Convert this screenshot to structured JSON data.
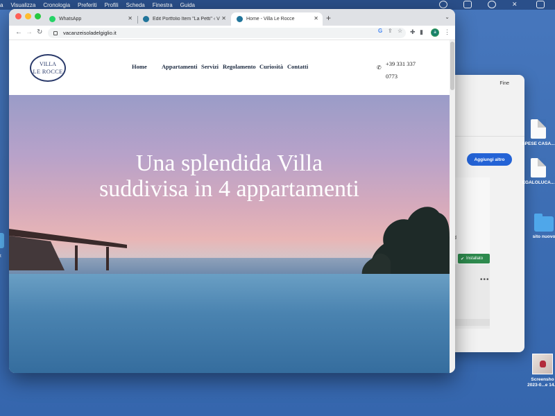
{
  "menubar": {
    "items": [
      "a",
      "Visualizza",
      "Cronologia",
      "Preferiti",
      "Profili",
      "Scheda",
      "Finestra",
      "Guida"
    ]
  },
  "browser": {
    "tabs": [
      {
        "title": "WhatsApp",
        "favicon": "whatsapp-icon",
        "color": "#25d366"
      },
      {
        "title": "Edit Portfolio Item \"La Petti\" ‹ V",
        "favicon": "wordpress-icon",
        "color": "#21759b"
      },
      {
        "title": "Home - Villa Le Rocce",
        "favicon": "wordpress-icon",
        "color": "#21759b",
        "active": true
      }
    ],
    "url": "vacanzeisoladelgiglio.it",
    "profile_initial": "a"
  },
  "site": {
    "logo_line1": "VILLA",
    "logo_line2": "LE ROCCE",
    "nav": [
      "Home",
      "Appartamenti",
      "Servizi",
      "Regolamento",
      "Curiosità",
      "Contatti"
    ],
    "phone": "+39 331 337 0773",
    "hero_title_line1": "Una splendida Villa",
    "hero_title_line2": "suddivisa in 4 appartamenti"
  },
  "background_window": {
    "done_label": "Fine",
    "add_button": "Aggiungi altro",
    "card_letter": "d",
    "installed_label": "Installato",
    "more_label": "•••"
  },
  "desktop_icons": [
    {
      "label": "SPESE CASA...",
      "type": "document"
    },
    {
      "label": "EGALOLUCA...",
      "type": "document"
    },
    {
      "label": "sito nuovo",
      "type": "folder"
    },
    {
      "label": "Screensho",
      "label2": "2023-0...e 14.3",
      "type": "screenshot"
    }
  ],
  "left_edge_label": "t"
}
